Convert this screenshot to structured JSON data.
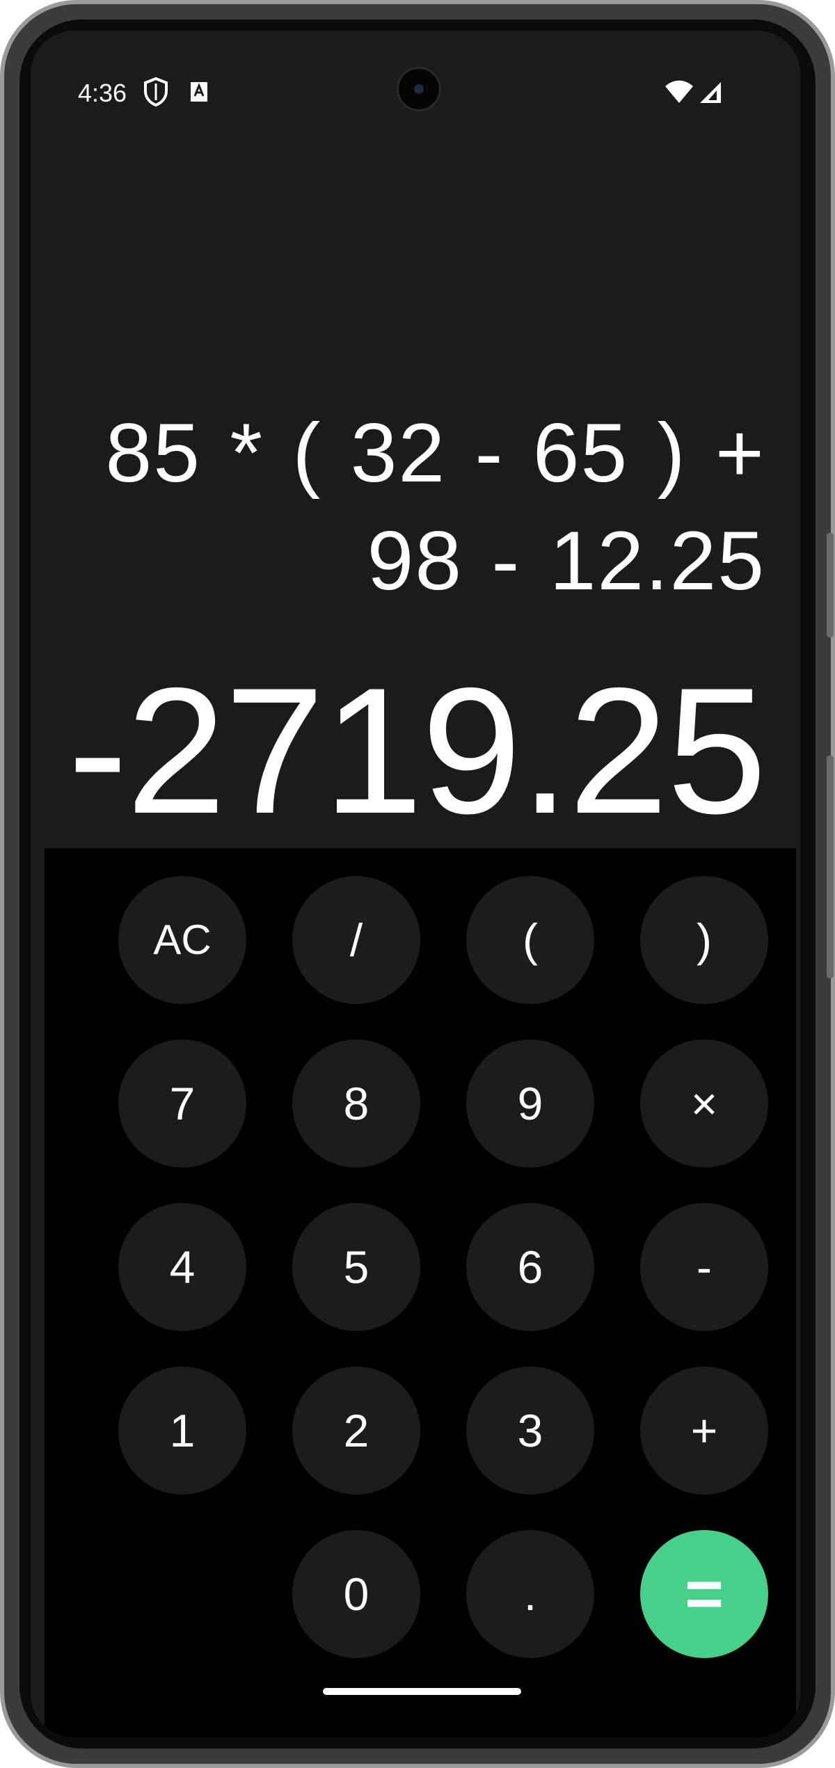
{
  "status_bar": {
    "time": "4:36",
    "left_icons": [
      "shield-icon",
      "keyboard-a-icon"
    ],
    "right_icons": [
      "wifi-icon",
      "cellular-signal-icon"
    ]
  },
  "display": {
    "expression": "85 * ( 32 - 65 ) + 98 - 12.25",
    "result": "-2719.25"
  },
  "keypad": {
    "rows": [
      [
        "AC",
        "/",
        "(",
        ")"
      ],
      [
        "7",
        "8",
        "9",
        "×"
      ],
      [
        "4",
        "5",
        "6",
        "-"
      ],
      [
        "1",
        "2",
        "3",
        "+"
      ],
      [
        "",
        "0",
        ".",
        "="
      ]
    ]
  },
  "colors": {
    "screen_background": "#1b1b1b",
    "keypad_background": "#000000",
    "key_background": "#1c1c1c",
    "equals_key": "#45d18a",
    "text": "#ffffff"
  }
}
